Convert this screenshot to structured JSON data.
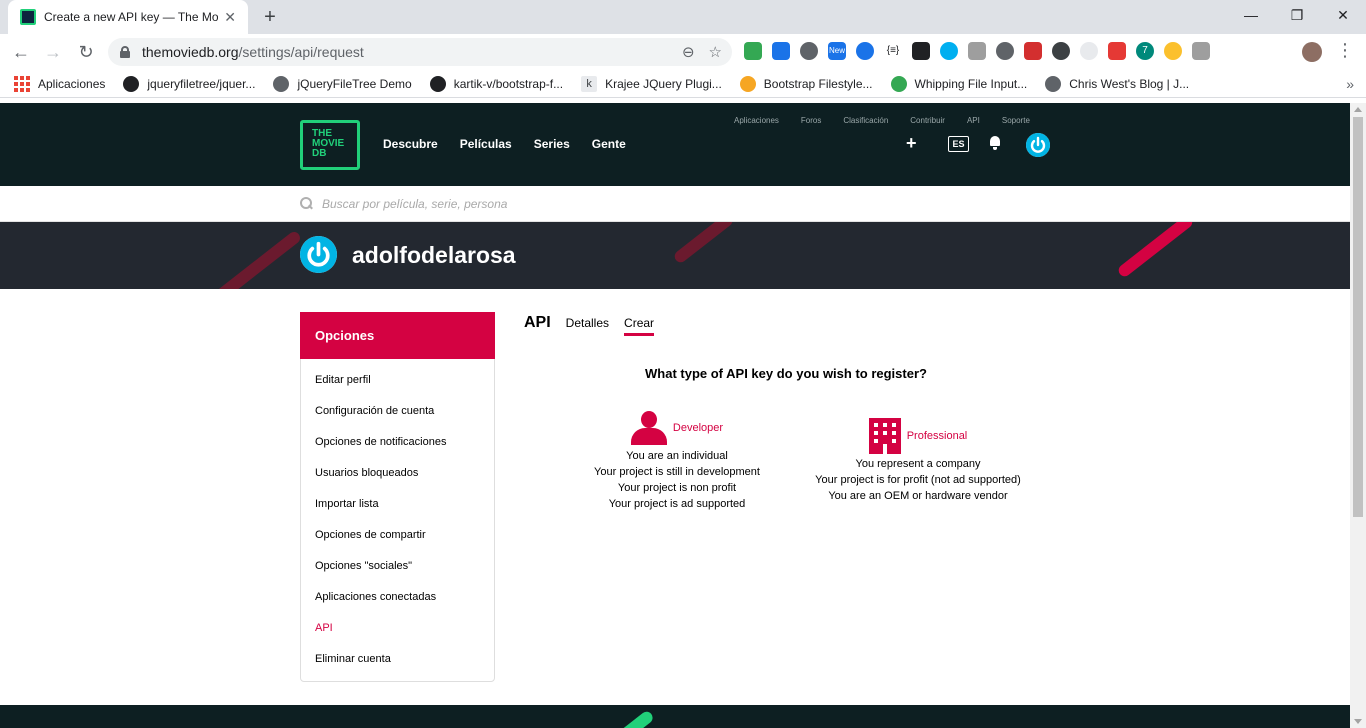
{
  "browser": {
    "tab_title": "Create a new API key — The Mov",
    "url_host": "themoviedb.org",
    "url_path": "/settings/api/request",
    "bookmarks": [
      "Aplicaciones",
      "jqueryfiletree/jquer...",
      "jQueryFileTree Demo",
      "kartik-v/bootstrap-f...",
      "Krajee JQuery Plugi...",
      "Bootstrap Filestyle...",
      "Whipping File Input...",
      "Chris West's Blog | J..."
    ],
    "extension_badge_new": "New",
    "extension_badge_count": "7"
  },
  "site": {
    "logo": [
      "THE",
      "MOVIE",
      "DB"
    ],
    "nav": [
      "Descubre",
      "Películas",
      "Series",
      "Gente"
    ],
    "subnav": [
      "Aplicaciones",
      "Foros",
      "Clasificación",
      "Contribuir",
      "API",
      "Soporte"
    ],
    "lang": "ES",
    "search_placeholder": "Buscar por película, serie, persona",
    "brand_green": "#21d07a",
    "accent": "#d40242"
  },
  "profile": {
    "username": "adolfodelarosa"
  },
  "sidebar": {
    "title": "Opciones",
    "items": [
      "Editar perfil",
      "Configuración de cuenta",
      "Opciones de notificaciones",
      "Usuarios bloqueados",
      "Importar lista",
      "Opciones de compartir",
      "Opciones \"sociales\"",
      "Aplicaciones conectadas",
      "API",
      "Eliminar cuenta"
    ],
    "active_index": 8
  },
  "content": {
    "section_title": "API",
    "tabs": [
      "Detalles",
      "Crear"
    ],
    "active_tab": "Crear",
    "question": "What type of API key do you wish to register?",
    "developer": {
      "label": "Developer",
      "lines": [
        "You are an individual",
        "Your project is still in development",
        "Your project is non profit",
        "Your project is ad supported"
      ]
    },
    "professional": {
      "label": "Professional",
      "lines": [
        "You represent a company",
        "Your project is for profit (not ad supported)",
        "You are an OEM or hardware vendor"
      ]
    }
  }
}
